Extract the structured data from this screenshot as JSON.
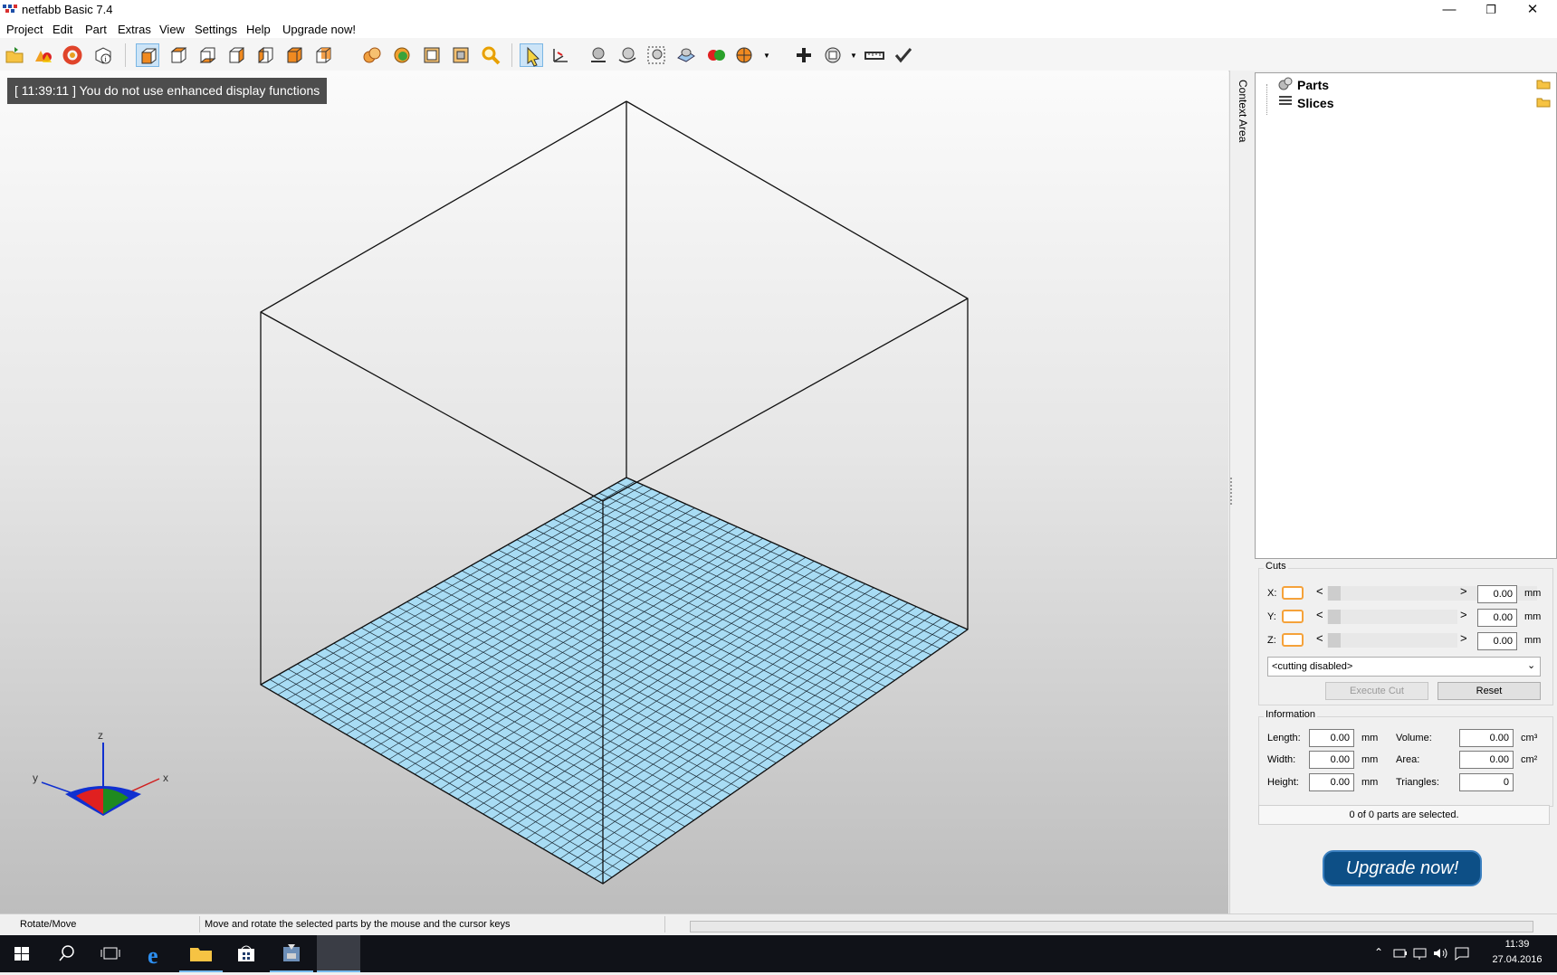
{
  "window": {
    "title": "netfabb Basic 7.4"
  },
  "menu": [
    "Project",
    "Edit",
    "Part",
    "Extras",
    "View",
    "Settings",
    "Help",
    "Upgrade now!"
  ],
  "viewport": {
    "message": "[ 11:39:11 ] You do not use enhanced display functions",
    "axes": {
      "x": "x",
      "y": "y",
      "z": "z"
    }
  },
  "context_tab": {
    "label": "Context Area"
  },
  "tree": {
    "items": [
      {
        "label": "Parts",
        "icon": "parts-icon"
      },
      {
        "label": "Slices",
        "icon": "slices-icon"
      }
    ]
  },
  "cuts": {
    "legend": "Cuts",
    "rows": [
      {
        "axis": "X:",
        "value": "0.00",
        "unit": "mm"
      },
      {
        "axis": "Y:",
        "value": "0.00",
        "unit": "mm"
      },
      {
        "axis": "Z:",
        "value": "0.00",
        "unit": "mm"
      }
    ],
    "left_arrow": "<",
    "right_arrow": ">",
    "mode_selected": "<cutting disabled>",
    "execute_label": "Execute Cut",
    "reset_label": "Reset"
  },
  "information": {
    "legend": "Information",
    "length_label": "Length:",
    "length_value": "0.00",
    "length_unit": "mm",
    "width_label": "Width:",
    "width_value": "0.00",
    "width_unit": "mm",
    "height_label": "Height:",
    "height_value": "0.00",
    "height_unit": "mm",
    "volume_label": "Volume:",
    "volume_value": "0.00",
    "volume_unit": "cm³",
    "area_label": "Area:",
    "area_value": "0.00",
    "area_unit": "cm²",
    "triangles_label": "Triangles:",
    "triangles_value": "0"
  },
  "selection_status": "0 of 0 parts are selected.",
  "upgrade_button": "Upgrade now!",
  "statusbar": {
    "mode": "Rotate/Move",
    "hint": "Move and rotate the selected parts by the mouse and the cursor keys"
  },
  "taskbar": {
    "time": "11:39",
    "date": "27.04.2016"
  },
  "colors": {
    "platform": "#a8dcf4",
    "accent": "#f5a23a",
    "upgrade": "#0d4f86"
  }
}
